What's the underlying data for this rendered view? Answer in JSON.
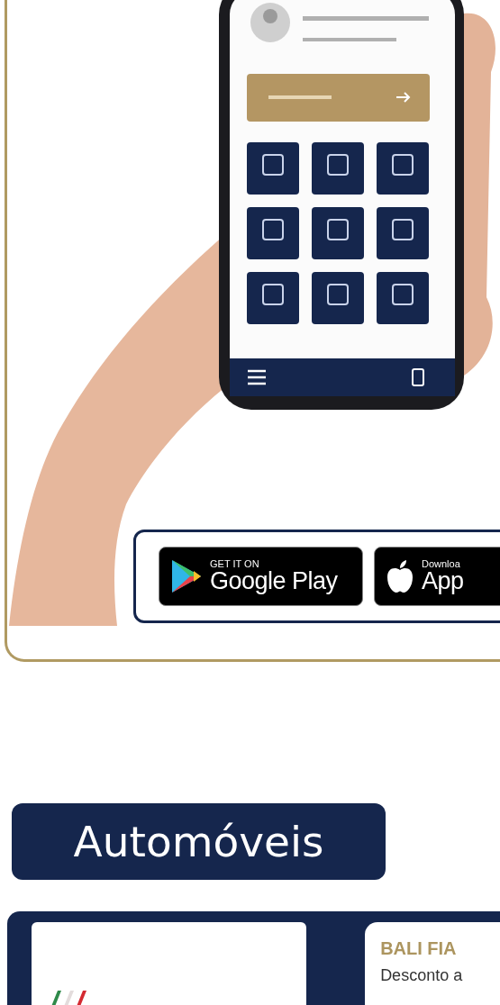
{
  "hero": {
    "store_badges": [
      {
        "kind": "google",
        "caption": "GET IT ON",
        "store": "Google Play"
      },
      {
        "kind": "apple",
        "caption": "Downloa",
        "store": "App"
      }
    ]
  },
  "section_title": "Automóveis",
  "listing": {
    "title": "BALI FIA",
    "description": "Desconto a"
  }
}
